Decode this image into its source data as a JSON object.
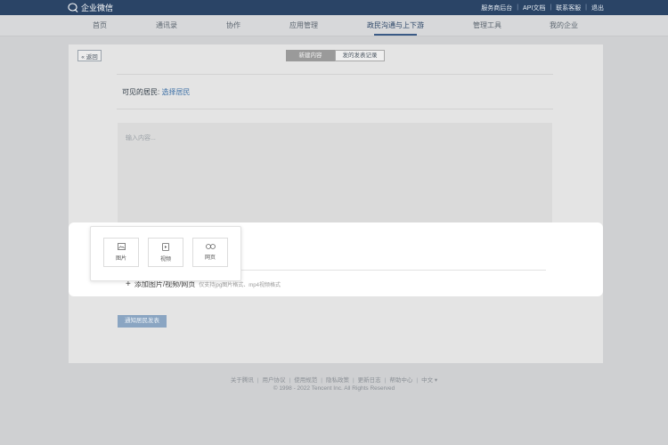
{
  "app": {
    "brand": "企业微信"
  },
  "toplinks": [
    "服务商后台",
    "API文档",
    "联系客服",
    "退出"
  ],
  "nav": {
    "items": [
      {
        "label": "首页"
      },
      {
        "label": "通讯录"
      },
      {
        "label": "协作"
      },
      {
        "label": "应用管理"
      },
      {
        "label": "政民沟通与上下游"
      },
      {
        "label": "管理工具"
      },
      {
        "label": "我的企业"
      }
    ],
    "active_index": 4
  },
  "card": {
    "back_label": "« 返回",
    "tabs": [
      "新建内容",
      "发的发表记录"
    ],
    "residents_label": "可见的居民:",
    "residents_link": "选择居民",
    "editor_placeholder": "输入内容...",
    "add_media_label": "添加图片/视频/网页",
    "add_media_hint": "仅支持jpg图片格式、mp4视频格式",
    "publish_label": "通知居民发表"
  },
  "media_popup": {
    "options": [
      {
        "label": "图片",
        "icon": "image-icon"
      },
      {
        "label": "视频",
        "icon": "video-icon"
      },
      {
        "label": "网页",
        "icon": "link-icon"
      }
    ]
  },
  "footer": {
    "links": [
      "关于腾讯",
      "用户协议",
      "使用规范",
      "隐私政策",
      "更新日志",
      "帮助中心",
      "中文 ▾"
    ],
    "copyright": "© 1998 - 2022 Tencent Inc. All Rights Reserved"
  },
  "colors": {
    "topbar": "#2a4466",
    "accent": "#3a6ea5",
    "publish_button": "#8aa5c2"
  }
}
